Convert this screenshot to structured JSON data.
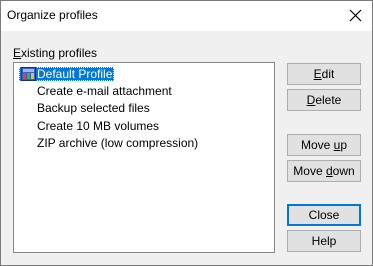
{
  "window": {
    "title": "Organize profiles",
    "close_glyph": "close-icon"
  },
  "profiles_group": {
    "label_mnemonic": "E",
    "label_rest": "xisting profiles"
  },
  "profiles": {
    "items": [
      {
        "label": "Default Profile",
        "selected": true,
        "icon": "profile-icon"
      },
      {
        "label": "Create e-mail attachment",
        "selected": false
      },
      {
        "label": "Backup selected files",
        "selected": false
      },
      {
        "label": "Create 10 MB volumes",
        "selected": false
      },
      {
        "label": "ZIP archive (low compression)",
        "selected": false
      }
    ]
  },
  "buttons": {
    "edit": {
      "pre": "",
      "mn": "E",
      "post": "dit"
    },
    "delete": {
      "pre": "",
      "mn": "D",
      "post": "elete"
    },
    "move_up": {
      "pre": "Move ",
      "mn": "u",
      "post": "p"
    },
    "move_down": {
      "pre": "Move ",
      "mn": "d",
      "post": "own"
    },
    "close": {
      "label": "Close"
    },
    "help": {
      "label": "Help"
    }
  },
  "colors": {
    "selection": "#0078d7",
    "dialog_bg": "#f0f0f0",
    "button_bg": "#e1e1e1",
    "default_border": "#0078d7"
  }
}
